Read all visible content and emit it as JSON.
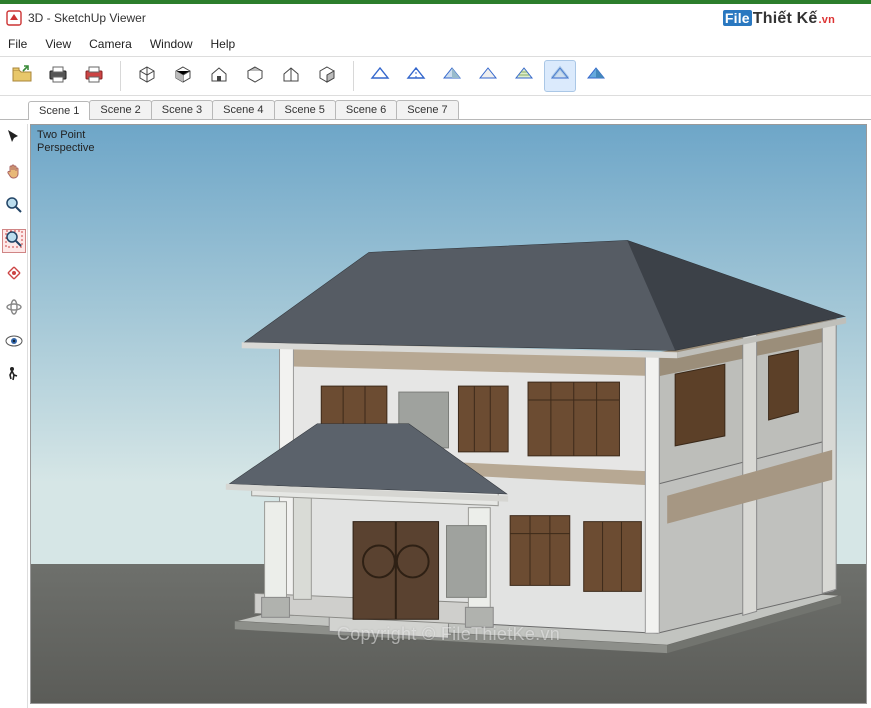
{
  "title": "3D - SketchUp Viewer",
  "logo": {
    "prefix": "File",
    "mid": "Thiết Kế",
    "suffix": ".vn"
  },
  "menu": {
    "file": "File",
    "view": "View",
    "camera": "Camera",
    "window": "Window",
    "help": "Help"
  },
  "scenes": [
    "Scene 1",
    "Scene 2",
    "Scene 3",
    "Scene 4",
    "Scene 5",
    "Scene 6",
    "Scene 7"
  ],
  "activeScene": 0,
  "viewLabel": "Two Point\nPerspective",
  "watermark": "Copyright © FileThietKe.vn",
  "toolbar": {
    "groups": [
      [
        "open-file",
        "print",
        "export-pdf"
      ],
      [
        "view-iso",
        "view-front",
        "view-home",
        "view-top",
        "view-right",
        "view-back"
      ],
      [
        "style-wire",
        "style-hidden",
        "style-shaded",
        "style-mono",
        "style-tex",
        "style-xray",
        "style-color"
      ]
    ],
    "active": "style-xray"
  },
  "sideTools": [
    "select",
    "pan-hand",
    "zoom",
    "zoom-window",
    "zoom-extents",
    "orbit",
    "look",
    "walk"
  ],
  "sideActive": "zoom-window"
}
